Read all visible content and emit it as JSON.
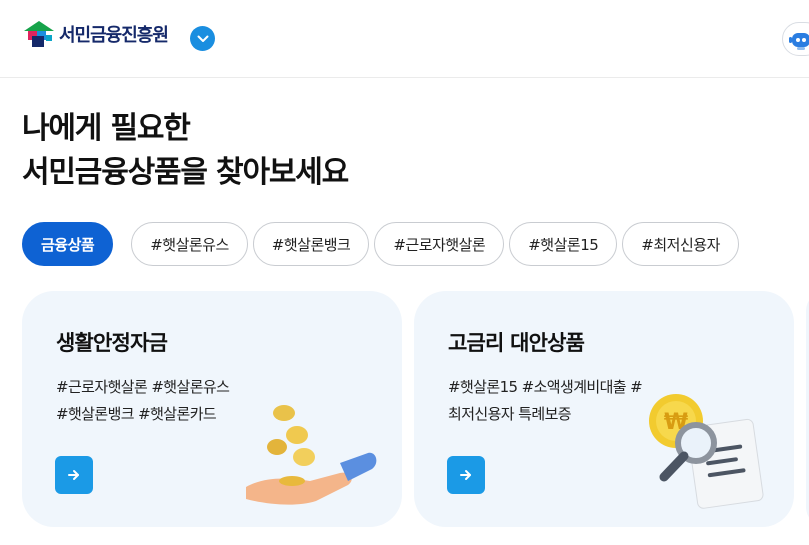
{
  "header": {
    "logo_text": "서민금융진흥원",
    "logo_toggle_icon": "chevron-down-icon",
    "chatbot_icon": "chatbot-icon",
    "colors": {
      "brand_navy": "#15296a",
      "accent_blue": "#1a8ee0"
    }
  },
  "hero": {
    "line1": "나에게 필요한",
    "line2": "서민금융상품을 찾아보세요"
  },
  "tags": [
    {
      "label": "금융상품",
      "active": true
    },
    {
      "label": "#햇살론유스",
      "active": false
    },
    {
      "label": "#햇살론뱅크",
      "active": false
    },
    {
      "label": "#근로자햇살론",
      "active": false
    },
    {
      "label": "#햇살론15",
      "active": false
    },
    {
      "label": "#최저신용자",
      "active": false
    }
  ],
  "cards": [
    {
      "title": "생활안정자금",
      "tags_line1": "#근로자햇살론 #햇살론유스",
      "tags_line2": "#햇살론뱅크 #햇살론카드",
      "arrow_icon": "arrow-right-icon",
      "illustration": "coins-hand-icon"
    },
    {
      "title": "고금리 대안상품",
      "tags_line1": "#햇살론15 #소액생계비대출 #",
      "tags_line2": "최저신용자 특례보증",
      "arrow_icon": "arrow-right-icon",
      "illustration": "won-coin-magnifier-icon"
    }
  ]
}
